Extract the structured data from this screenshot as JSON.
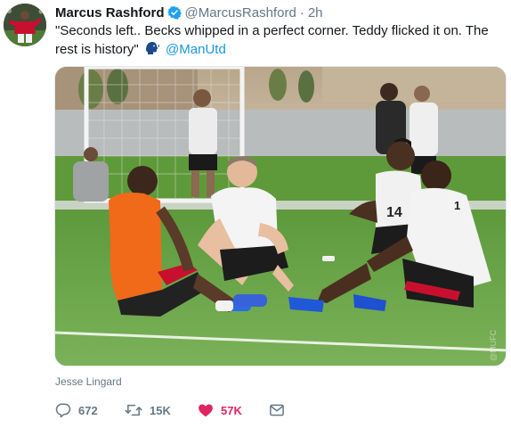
{
  "tweet": {
    "display_name": "Marcus Rashford",
    "handle": "@MarcusRashford",
    "separator": "·",
    "time": "2h",
    "text": "\"Seconds left.. Becks whipped in a perfect corner. Teddy flicked it on. The rest is history\"",
    "mention": "@ManUtd",
    "emoji": "speaking-head-icon",
    "photo_credit": "Jesse Lingard"
  },
  "actions": {
    "reply": {
      "icon": "reply-icon",
      "count": "672"
    },
    "retweet": {
      "icon": "retweet-icon",
      "count": "15K"
    },
    "like": {
      "icon": "heart-icon",
      "count": "57K",
      "color": "#e0245e"
    },
    "message": {
      "icon": "envelope-icon"
    }
  },
  "colors": {
    "link": "#1b95e0",
    "muted": "#657786",
    "text": "#14171a",
    "verified": "#1da1f2"
  }
}
